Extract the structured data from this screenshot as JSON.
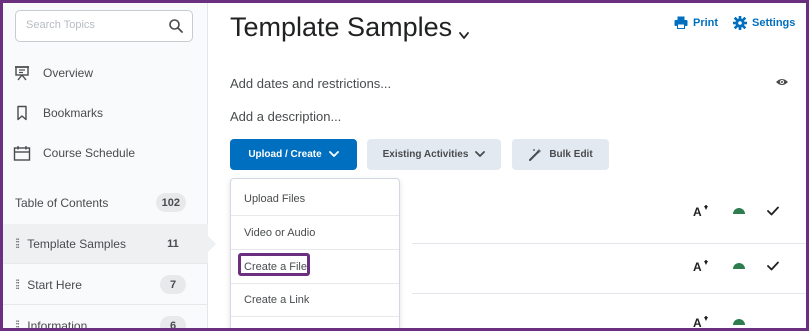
{
  "sidebar": {
    "search_placeholder": "Search Topics",
    "nav": [
      {
        "label": "Overview"
      },
      {
        "label": "Bookmarks"
      },
      {
        "label": "Course Schedule"
      }
    ],
    "toc": {
      "label": "Table of Contents",
      "count": "102"
    },
    "modules": [
      {
        "label": "Template Samples",
        "count": "11"
      },
      {
        "label": "Start Here",
        "count": "7"
      },
      {
        "label": "Information",
        "count": "6"
      }
    ]
  },
  "header": {
    "title": "Template Samples",
    "print_label": "Print",
    "settings_label": "Settings"
  },
  "main": {
    "dates_text": "Add dates and restrictions...",
    "description_text": "Add a description...",
    "toolbar": {
      "upload_create_label": "Upload / Create",
      "existing_activities_label": "Existing Activities",
      "bulk_edit_label": "Bulk Edit"
    },
    "dropdown_items": [
      {
        "label": "Upload Files"
      },
      {
        "label": "Video or Audio"
      },
      {
        "label": "Create a File"
      },
      {
        "label": "Create a Link"
      }
    ]
  },
  "colors": {
    "accent": "#006fbf",
    "highlight": "#6b2f7f",
    "success": "#2e7d4f"
  }
}
